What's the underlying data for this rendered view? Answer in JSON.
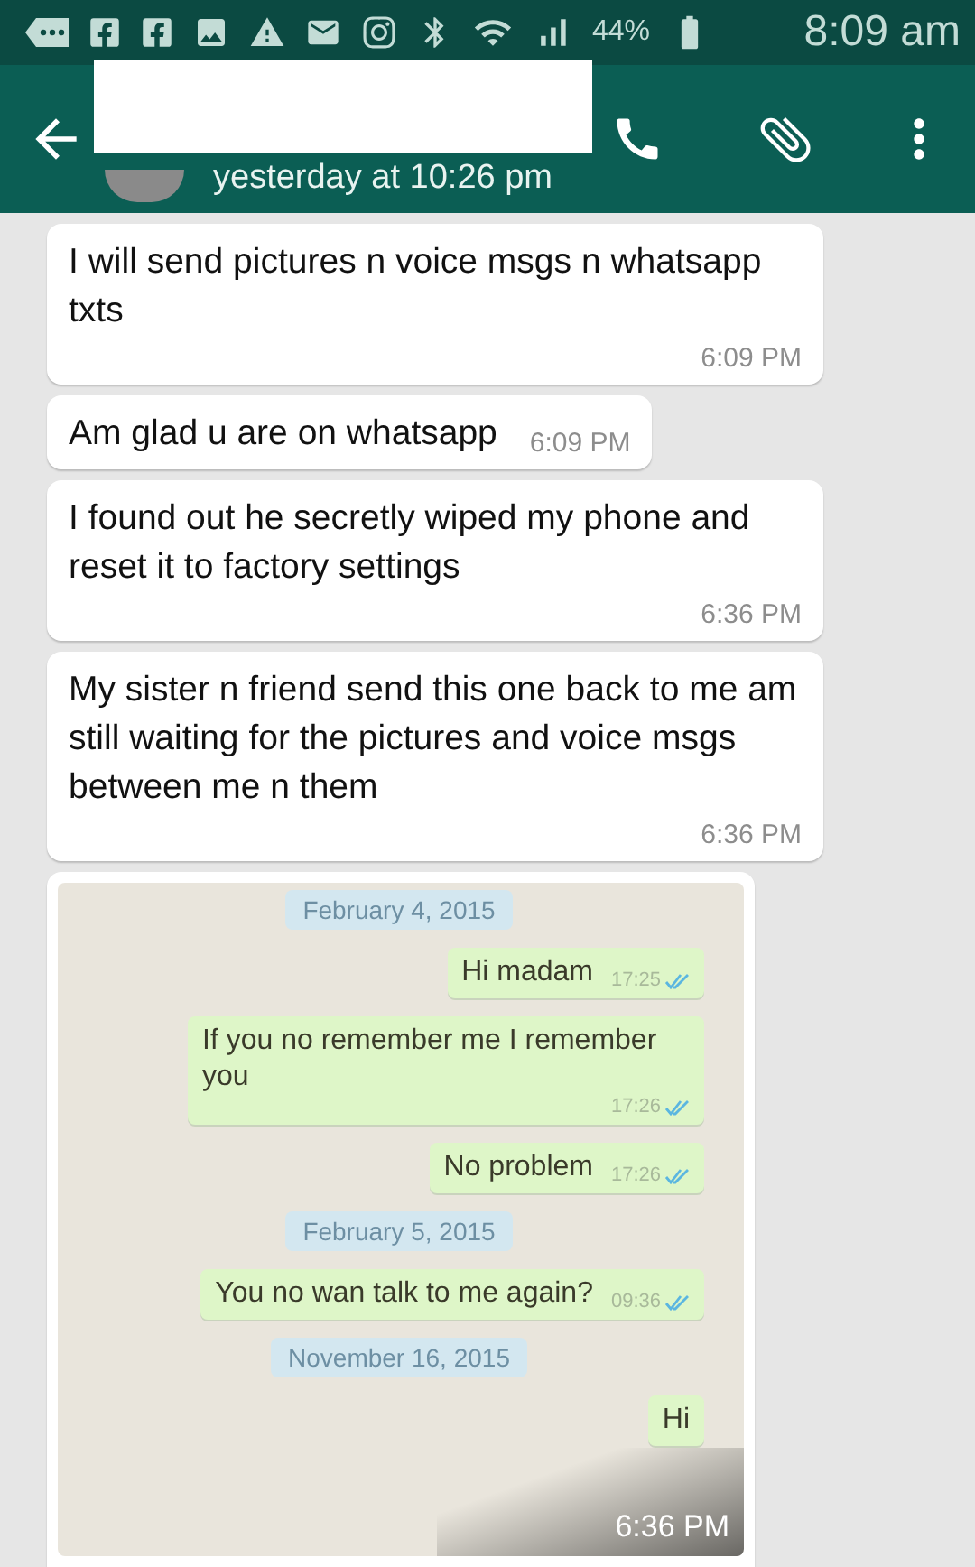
{
  "status_bar": {
    "battery": "44%",
    "time": "8:09 am"
  },
  "header": {
    "last_seen": "yesterday at 10:26 pm"
  },
  "messages": [
    {
      "kind": "text",
      "text": "I will send pictures n voice msgs n whatsapp txts",
      "time": "6:09 PM"
    },
    {
      "kind": "text",
      "text": "Am glad u are on whatsapp",
      "time": "6:09 PM"
    },
    {
      "kind": "text",
      "text": "I found out he secretly  wiped my phone and reset it to factory settings",
      "time": "6:36 PM"
    },
    {
      "kind": "text",
      "text": "My sister n friend send this one back to me am still waiting for the pictures and voice msgs between me n them",
      "time": "6:36 PM"
    },
    {
      "kind": "image",
      "time": "6:36 PM",
      "screenshot": [
        {
          "kind": "date",
          "text": "February 4, 2015"
        },
        {
          "kind": "out",
          "text": "Hi madam",
          "time": "17:25"
        },
        {
          "kind": "out",
          "text": "If you no remember me I remember you",
          "time": "17:26"
        },
        {
          "kind": "out",
          "text": "No problem",
          "time": "17:26"
        },
        {
          "kind": "date",
          "text": "February 5, 2015"
        },
        {
          "kind": "out",
          "text": "You no wan talk to me again?",
          "time": "09:36"
        },
        {
          "kind": "date",
          "text": "November 16, 2015"
        },
        {
          "kind": "out",
          "text": "Hi"
        }
      ]
    }
  ]
}
